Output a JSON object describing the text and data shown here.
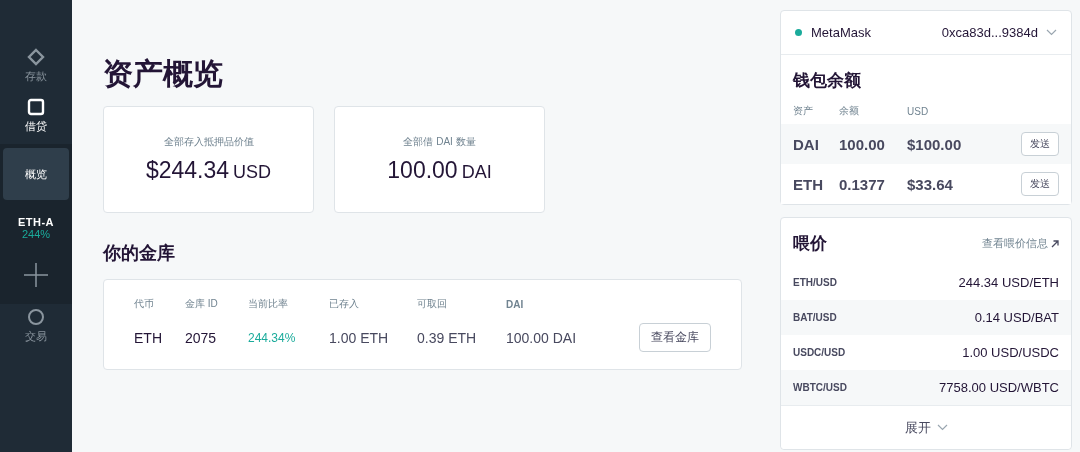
{
  "sidebar": {
    "items": [
      {
        "kind": "deposit",
        "label": "存款",
        "active": false
      },
      {
        "kind": "borrow",
        "label": "借贷",
        "active": true
      },
      {
        "kind": "sub",
        "label": "概览",
        "selected": true
      },
      {
        "kind": "vault",
        "label": "ETH-A",
        "ratio": "244%",
        "selected": false
      },
      {
        "kind": "add"
      },
      {
        "kind": "trade",
        "label": "交易",
        "active": false
      }
    ]
  },
  "main": {
    "title": "资产概览",
    "stats": [
      {
        "label": "全部存入抵押品价值",
        "value": "$244.34",
        "unit": "USD"
      },
      {
        "label": "全部借 DAI 数量",
        "value": "100.00",
        "unit": "DAI"
      }
    ],
    "vaults_title": "你的金库",
    "vaults": {
      "columns": [
        "代币",
        "金库 ID",
        "当前比率",
        "已存入",
        "可取回",
        "DAI"
      ],
      "rows": [
        {
          "cells": [
            "ETH",
            "2075",
            "244.34%",
            "1.00 ETH",
            "0.39 ETH",
            "100.00 DAI"
          ],
          "button": "查看金库"
        }
      ]
    }
  },
  "wallet": {
    "connected": true,
    "name": "MetaMask",
    "address": "0xca83d...9384d",
    "title": "钱包余额",
    "columns": [
      "资产",
      "余额",
      "USD"
    ],
    "rows": [
      {
        "cells": [
          "DAI",
          "100.00",
          "$100.00"
        ],
        "button": "发送"
      },
      {
        "cells": [
          "ETH",
          "0.1377",
          "$33.64"
        ],
        "button": "发送"
      }
    ]
  },
  "feeds": {
    "title": "喂价",
    "link": "查看喂价信息",
    "rows": [
      {
        "pair": "ETH/USD",
        "price": "244.34 USD/ETH"
      },
      {
        "pair": "BAT/USD",
        "price": "0.14 USD/BAT"
      },
      {
        "pair": "USDC/USD",
        "price": "1.00 USD/USDC"
      },
      {
        "pair": "WBTC/USD",
        "price": "7758.00 USD/WBTC"
      }
    ],
    "expand": "展开"
  }
}
